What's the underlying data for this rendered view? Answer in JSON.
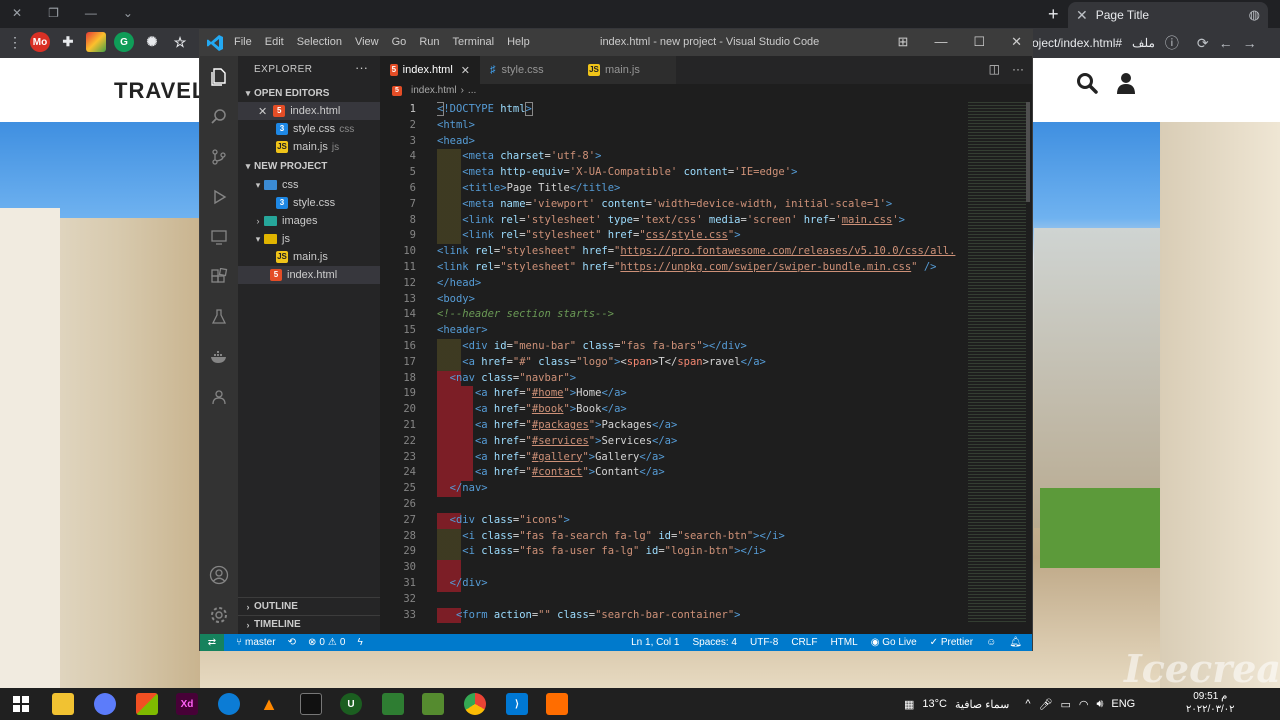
{
  "browser": {
    "tab_title": "Page Title",
    "url_text": "oject/index.html#",
    "url_prefix": "ملف",
    "profile_initials": "Mo"
  },
  "website": {
    "logo_text": "TRAVEL"
  },
  "vscode": {
    "title": "index.html - new project - Visual Studio Code",
    "menu": [
      "File",
      "Edit",
      "Selection",
      "View",
      "Go",
      "Run",
      "Terminal",
      "Help"
    ],
    "explorer_title": "EXPLORER",
    "open_editors_label": "OPEN EDITORS",
    "project_label": "NEW PROJECT",
    "outline_label": "OUTLINE",
    "timeline_label": "TIMELINE",
    "open_editors": [
      {
        "name": "index.html",
        "dir": ""
      },
      {
        "name": "style.css",
        "dir": "css"
      },
      {
        "name": "main.js",
        "dir": "js"
      }
    ],
    "tree": [
      {
        "name": "css"
      },
      {
        "name": "style.css"
      },
      {
        "name": "images"
      },
      {
        "name": "js"
      },
      {
        "name": "main.js"
      },
      {
        "name": "index.html"
      }
    ],
    "tabs": [
      {
        "label": "index.html"
      },
      {
        "label": "style.css"
      },
      {
        "label": "main.js"
      }
    ],
    "breadcrumb": {
      "file": "index.html",
      "more": "..."
    },
    "line_numbers": [
      "1",
      "2",
      "3",
      "4",
      "5",
      "6",
      "7",
      "8",
      "9",
      "10",
      "11",
      "12",
      "13",
      "14",
      "15",
      "16",
      "17",
      "18",
      "19",
      "20",
      "21",
      "22",
      "23",
      "24",
      "25",
      "26",
      "27",
      "28",
      "29",
      "30",
      "31",
      "32",
      "33"
    ],
    "status": {
      "branch": "master",
      "errors": "0",
      "warnings": "0",
      "position": "Ln 1, Col 1",
      "spaces": "Spaces: 4",
      "encoding": "UTF-8",
      "eol": "CRLF",
      "language": "HTML",
      "go_live": "Go Live",
      "prettier": "Prettier"
    }
  },
  "taskbar": {
    "temperature": "13°C",
    "weather": "سماء صافية",
    "language": "ENG",
    "time": "09:51 م",
    "date": "٢٠٢٢/٠٣/٠٢"
  },
  "watermark": "Icecream",
  "colors": {
    "vscode_status": "#007acc",
    "vscode_bg": "#1e1e1e",
    "html_tag": "#569cd6",
    "attr": "#9cdcfe",
    "string": "#ce9178",
    "comment": "#6a9955"
  }
}
